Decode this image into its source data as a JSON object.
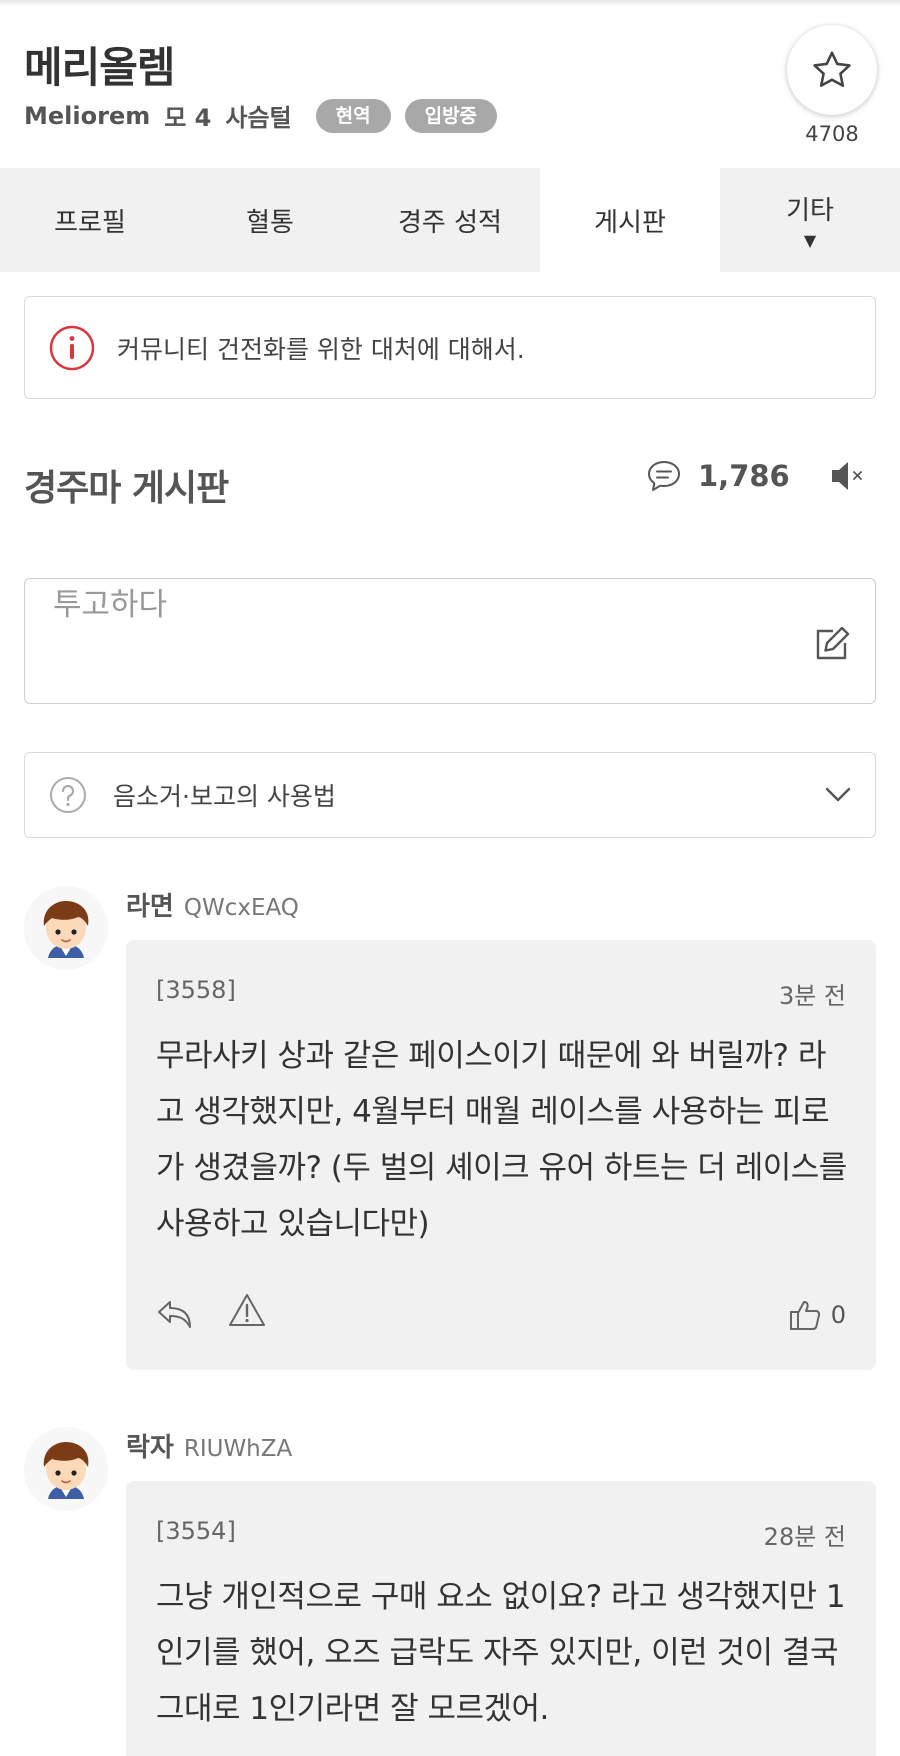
{
  "horse": {
    "name": "메리올렘",
    "name_en": "Meliorem",
    "sex_age": "모 4",
    "color": "사슴털",
    "badge_status": "현역",
    "badge_stable": "입방중",
    "favorite_count": "4708"
  },
  "tabs": [
    {
      "label": "프로필",
      "active": false
    },
    {
      "label": "혈통",
      "active": false
    },
    {
      "label": "경주 성적",
      "active": false
    },
    {
      "label": "게시판",
      "active": true
    },
    {
      "label": "기타",
      "active": false,
      "caret": "▼"
    }
  ],
  "notice": {
    "text": "커뮤니티 건전화를 위한 대처에 대해서.",
    "icon": "info-icon"
  },
  "board": {
    "title": "경주마 게시판",
    "comment_count": "1,786"
  },
  "post_box": {
    "placeholder": "투고하다"
  },
  "howto": {
    "text": "음소거·보고의 사용법"
  },
  "comments": [
    {
      "nick": "라면",
      "uid": "QWcxEAQ",
      "number": "[3558]",
      "time": "3분 전",
      "body": "무라사키 상과 같은 페이스이기 때문에 와 버릴까? 라고 생각했지만, 4월부터 매월 레이스를 사용하는 피로가 생겼을까? (두 벌의 셰이크 유어 하트는 더 레이스를 사용하고 있습니다만)",
      "likes": "0"
    },
    {
      "nick": "락자",
      "uid": "RIUWhZA",
      "number": "[3554]",
      "time": "28분 전",
      "body": "그냥 개인적으로 구매 요소 없이요? 라고 생각했지만 1인기를 했어, 오즈 급락도 자주 있지만, 이런 것이 결국 그대로 1인기라면 잘 모르겠어.",
      "likes": ""
    }
  ],
  "colors": {
    "accent_red": "#d9363e",
    "badge_gray": "#a8a8a8",
    "tab_bg": "#f1f1f1",
    "bubble_bg": "#f1f1f1"
  }
}
